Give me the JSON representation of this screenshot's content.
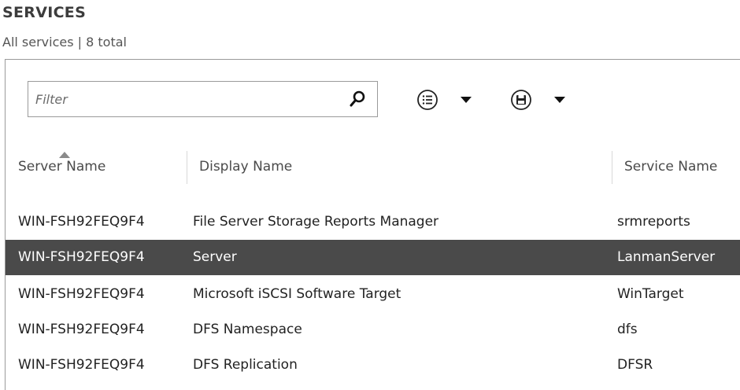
{
  "header": {
    "title": "SERVICES",
    "subtitle": "All services | 8 total"
  },
  "toolbar": {
    "filter_placeholder": "Filter",
    "filter_value": "",
    "icons": [
      "search-icon",
      "list-view-icon",
      "save-icon",
      "chevron-down-icon"
    ]
  },
  "table": {
    "columns": [
      "Server Name",
      "Display Name",
      "Service Name"
    ],
    "sorted_column": "Server Name",
    "rows": [
      {
        "server": "WIN-FSH92FEQ9F4",
        "display": "File Server Storage Reports Manager",
        "service": "srmreports"
      },
      {
        "server": "WIN-FSH92FEQ9F4",
        "display": "Server",
        "service": "LanmanServer"
      },
      {
        "server": "WIN-FSH92FEQ9F4",
        "display": "Microsoft iSCSI Software Target",
        "service": "WinTarget"
      },
      {
        "server": "WIN-FSH92FEQ9F4",
        "display": "DFS Namespace",
        "service": "dfs"
      },
      {
        "server": "WIN-FSH92FEQ9F4",
        "display": "DFS Replication",
        "service": "DFSR"
      }
    ],
    "selected_row": 1
  },
  "colors": {
    "selected_row_bg": "#4a4a4a",
    "border": "#9a9a9a",
    "text": "#222222"
  }
}
